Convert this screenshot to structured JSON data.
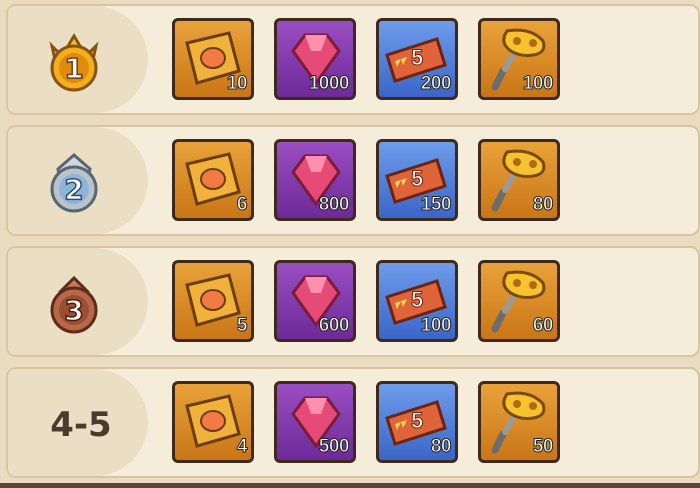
{
  "rows": [
    {
      "rank": "1",
      "rank_style": "gold-crown",
      "items": [
        {
          "icon": "scroll-ticket-icon",
          "qty": "10"
        },
        {
          "icon": "ruby-gem-icon",
          "qty": "1000"
        },
        {
          "icon": "speedup-ticket-icon",
          "qty": "200"
        },
        {
          "icon": "wind-up-key-icon",
          "qty": "100"
        }
      ]
    },
    {
      "rank": "2",
      "rank_style": "silver-crown",
      "items": [
        {
          "icon": "scroll-ticket-icon",
          "qty": "6"
        },
        {
          "icon": "ruby-gem-icon",
          "qty": "800"
        },
        {
          "icon": "speedup-ticket-icon",
          "qty": "150"
        },
        {
          "icon": "wind-up-key-icon",
          "qty": "80"
        }
      ]
    },
    {
      "rank": "3",
      "rank_style": "bronze-crown",
      "items": [
        {
          "icon": "scroll-ticket-icon",
          "qty": "5"
        },
        {
          "icon": "ruby-gem-icon",
          "qty": "600"
        },
        {
          "icon": "speedup-ticket-icon",
          "qty": "100"
        },
        {
          "icon": "wind-up-key-icon",
          "qty": "60"
        }
      ]
    },
    {
      "rank": "4-5",
      "rank_style": "text",
      "items": [
        {
          "icon": "scroll-ticket-icon",
          "qty": "4"
        },
        {
          "icon": "ruby-gem-icon",
          "qty": "500"
        },
        {
          "icon": "speedup-ticket-icon",
          "qty": "80"
        },
        {
          "icon": "wind-up-key-icon",
          "qty": "50"
        }
      ]
    }
  ],
  "ticket_badge": "5",
  "colors": {
    "gold": "#f2b019",
    "silver": "#b9c3cc",
    "bronze": "#b8684a"
  }
}
